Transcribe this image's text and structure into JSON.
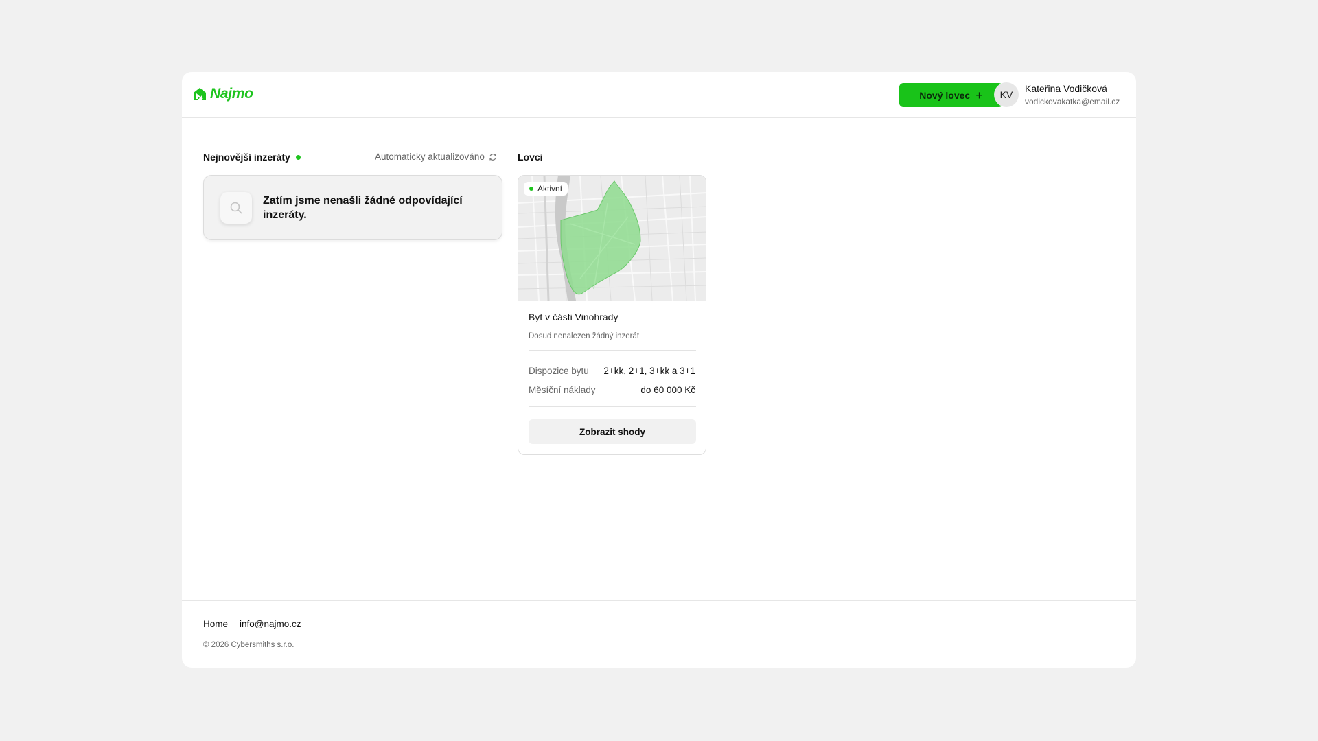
{
  "brand": {
    "name": "Najmo",
    "color": "#1ec41e"
  },
  "header": {
    "new_hunter_label": "Nový lovec",
    "user": {
      "initials": "KV",
      "name": "Kateřina Vodičková",
      "email": "vodickovakatka@email.cz"
    }
  },
  "listings": {
    "title": "Nejnovější inzeráty",
    "auto_updated": "Automaticky aktualizováno",
    "empty_message": "Zatím jsme nenašli žádné odpovídající inzeráty."
  },
  "hunters": {
    "title": "Lovci",
    "items": [
      {
        "badge": "Aktivní",
        "name": "Byt v části Vinohrady",
        "status": "Dosud nenalezen žádný inzerát",
        "rows": [
          {
            "label": "Dispozice bytu",
            "value": "2+kk, 2+1, 3+kk a 3+1"
          },
          {
            "label": "Měsíční náklady",
            "value": "do 60 000 Kč"
          }
        ],
        "button_label": "Zobrazit shody"
      }
    ]
  },
  "footer": {
    "links": [
      "Home",
      "info@najmo.cz"
    ],
    "copyright": "© 2026 Cybersmiths s.r.o."
  }
}
